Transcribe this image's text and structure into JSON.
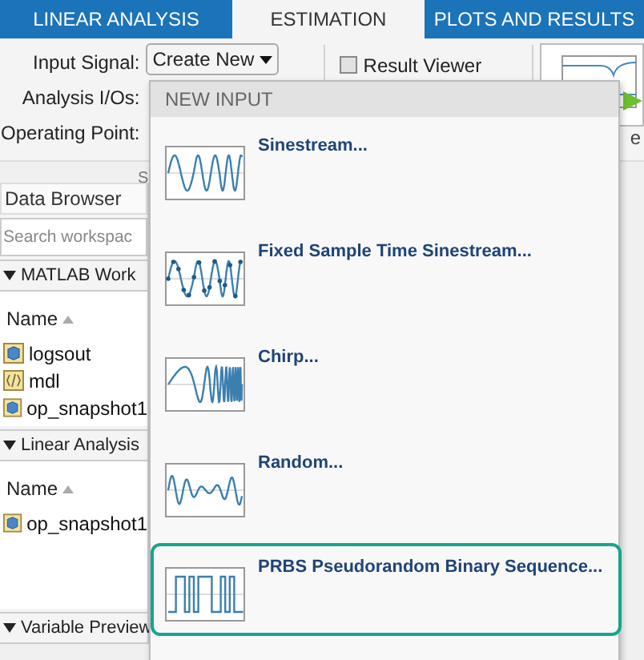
{
  "tabs": [
    {
      "label": "LINEAR ANALYSIS",
      "selected": false
    },
    {
      "label": "ESTIMATION",
      "selected": true
    },
    {
      "label": "PLOTS AND RESULTS",
      "selected": false
    }
  ],
  "toolstrip": {
    "input_signal_label": "Input Signal:",
    "input_signal_button": "Create New",
    "analysis_ios_label": "Analysis I/Os:",
    "operating_point_label": "Operating Point:",
    "result_viewer": {
      "label": "Result Viewer",
      "checked": false
    },
    "section_label": "S",
    "preview_label": "e"
  },
  "data_browser": {
    "title": "Data Browser",
    "search": {
      "placeholder": "Search workspac"
    },
    "panels": [
      {
        "title": "MATLAB Work",
        "expanded": true,
        "column": "Name",
        "rows": [
          {
            "name": "logsout",
            "kind": "object"
          },
          {
            "name": "mdl",
            "kind": "class"
          },
          {
            "name": "op_snapshot1",
            "kind": "object"
          }
        ]
      },
      {
        "title": "Linear Analysis",
        "expanded": true,
        "column": "Name",
        "rows": [
          {
            "name": "op_snapshot1",
            "kind": "object"
          }
        ]
      },
      {
        "title": "Variable Preview",
        "expanded": true
      }
    ]
  },
  "menu": {
    "header": "NEW INPUT",
    "items": [
      {
        "label": "Sinestream...",
        "kind": "sinestream",
        "selected": false
      },
      {
        "label": "Fixed Sample Time Sinestream...",
        "kind": "fixed",
        "selected": false
      },
      {
        "label": "Chirp...",
        "kind": "chirp",
        "selected": false
      },
      {
        "label": "Random...",
        "kind": "random",
        "selected": false
      },
      {
        "label": "PRBS Pseudorandom Binary Sequence...",
        "kind": "prbs",
        "selected": true
      }
    ]
  }
}
